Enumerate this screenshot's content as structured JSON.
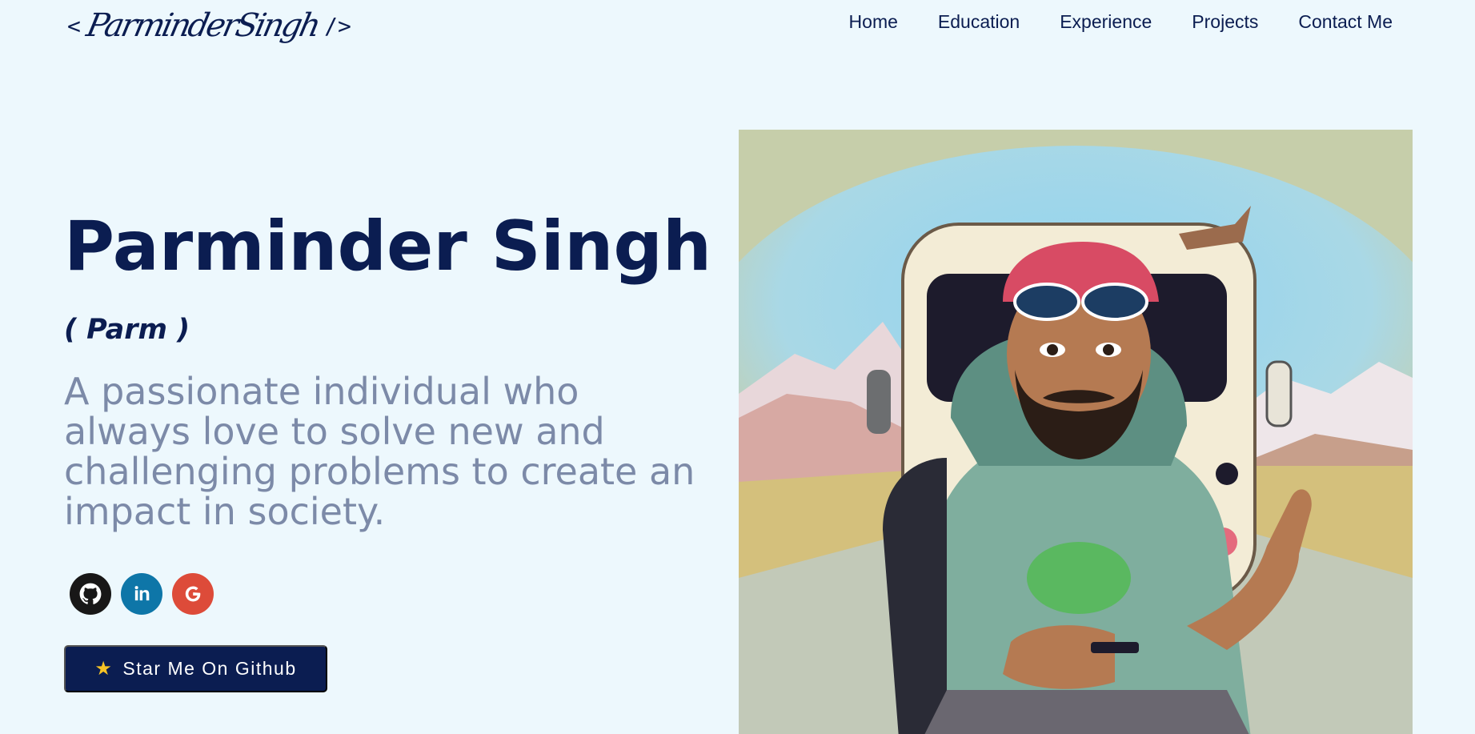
{
  "header": {
    "logo_open": "<",
    "logo_name": "ParminderSingh",
    "logo_close": "/>",
    "nav": [
      "Home",
      "Education",
      "Experience",
      "Projects",
      "Contact Me"
    ]
  },
  "hero": {
    "name": "Parminder Singh",
    "nickname": "( Parm )",
    "tagline": "A passionate individual who always love to solve new and challenging problems to create an impact in society.",
    "socials": [
      {
        "icon": "github-icon",
        "color": "#181717"
      },
      {
        "icon": "linkedin-icon",
        "color": "#0e76a8"
      },
      {
        "icon": "google-icon",
        "color": "#dd4b39"
      }
    ],
    "cta_label": "Star Me On Github",
    "cta_icon": "star-icon"
  },
  "colors": {
    "background": "#edf8fd",
    "primary": "#0b1d51",
    "muted_text": "#7c8aa8",
    "star": "#f7c325"
  }
}
